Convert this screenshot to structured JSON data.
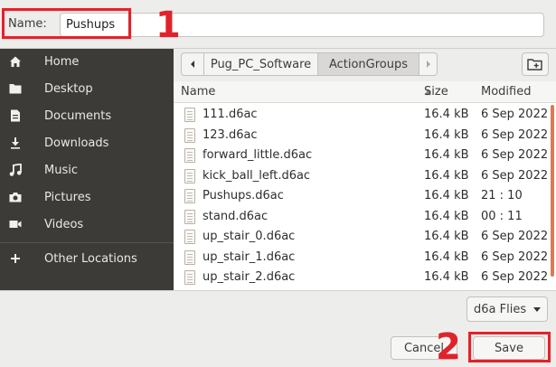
{
  "namebar": {
    "label": "Name:",
    "value": "Pushups"
  },
  "annotations": {
    "marker_1": "1",
    "marker_2": "2",
    "color": "#e0232a"
  },
  "sidebar": {
    "items": [
      {
        "label": "Home",
        "icon": "home-icon"
      },
      {
        "label": "Desktop",
        "icon": "folder-icon"
      },
      {
        "label": "Documents",
        "icon": "document-icon"
      },
      {
        "label": "Downloads",
        "icon": "download-icon"
      },
      {
        "label": "Music",
        "icon": "music-icon"
      },
      {
        "label": "Pictures",
        "icon": "camera-icon"
      },
      {
        "label": "Videos",
        "icon": "video-icon"
      }
    ],
    "other": {
      "label": "Other Locations",
      "icon": "plus-icon"
    }
  },
  "pathbar": {
    "crumbs": [
      "Pug_PC_Software",
      "ActionGroups"
    ]
  },
  "filelist": {
    "headers": {
      "name": "Name",
      "size": "Size",
      "modified": "Modified"
    },
    "rows": [
      {
        "name": "111.d6ac",
        "size": "16.4 kB",
        "modified": "6 Sep 2022"
      },
      {
        "name": "123.d6ac",
        "size": "16.4 kB",
        "modified": "6 Sep 2022"
      },
      {
        "name": "forward_little.d6ac",
        "size": "16.4 kB",
        "modified": "6 Sep 2022"
      },
      {
        "name": "kick_ball_left.d6ac",
        "size": "16.4 kB",
        "modified": "6 Sep 2022"
      },
      {
        "name": "Pushups.d6ac",
        "size": "16.4 kB",
        "modified": "21 : 10"
      },
      {
        "name": "stand.d6ac",
        "size": "16.4 kB",
        "modified": "00 : 11"
      },
      {
        "name": "up_stair_0.d6ac",
        "size": "16.4 kB",
        "modified": "6 Sep 2022"
      },
      {
        "name": "up_stair_1.d6ac",
        "size": "16.4 kB",
        "modified": "6 Sep 2022"
      },
      {
        "name": "up_stair_2.d6ac",
        "size": "16.4 kB",
        "modified": "6 Sep 2022"
      }
    ]
  },
  "filter": {
    "label": "d6a Flies"
  },
  "buttons": {
    "cancel": "Cancel",
    "save": "Save"
  },
  "colors": {
    "sidebar_bg": "#3c3b37",
    "scrollbar": "#e07a4a",
    "highlight": "#e0232a"
  }
}
